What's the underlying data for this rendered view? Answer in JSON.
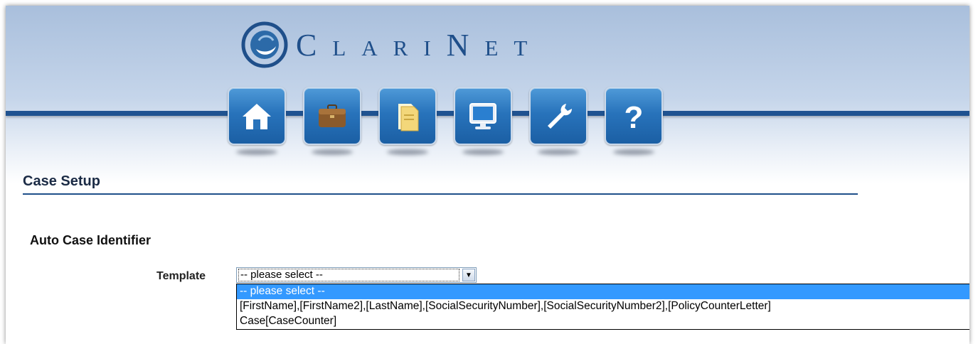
{
  "logo": {
    "text": "ClariNet"
  },
  "nav": {
    "items": [
      {
        "name": "home",
        "icon": "home-icon"
      },
      {
        "name": "briefcase",
        "icon": "briefcase-icon"
      },
      {
        "name": "documents",
        "icon": "folder-documents-icon"
      },
      {
        "name": "monitor",
        "icon": "monitor-icon"
      },
      {
        "name": "tools",
        "icon": "wrench-icon"
      },
      {
        "name": "help",
        "icon": "help-icon"
      }
    ]
  },
  "page": {
    "title": "Case Setup",
    "section_title": "Auto Case Identifier"
  },
  "template_field": {
    "label": "Template",
    "selected": "-- please select --",
    "options": [
      "-- please select --",
      "[FirstName],[FirstName2],[LastName],[SocialSecurityNumber],[SocialSecurityNumber2],[PolicyCounterLetter]",
      "Case[CaseCounter]"
    ],
    "highlighted_index": 0
  },
  "colors": {
    "brand": "#1f4f8a",
    "nav_button": "#2873bb",
    "highlight": "#3399ff"
  }
}
